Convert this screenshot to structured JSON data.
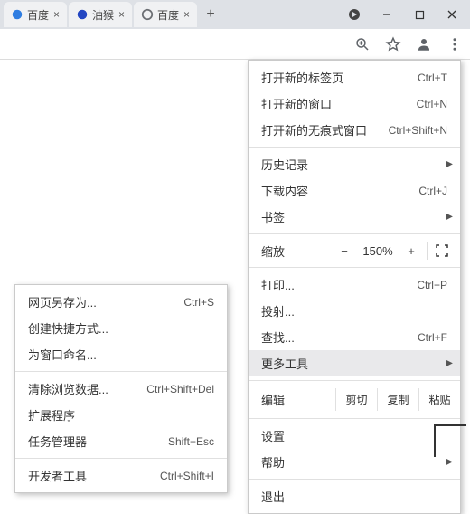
{
  "tabs": [
    {
      "title": "百度",
      "fav_color": "#2f7de1"
    },
    {
      "title": "油猴",
      "fav_color": "#2346c2"
    },
    {
      "title": "百度",
      "fav_color": "#6b6e73"
    }
  ],
  "menu": {
    "new_tab": {
      "label": "打开新的标签页",
      "shortcut": "Ctrl+T"
    },
    "new_window": {
      "label": "打开新的窗口",
      "shortcut": "Ctrl+N"
    },
    "incognito": {
      "label": "打开新的无痕式窗口",
      "shortcut": "Ctrl+Shift+N"
    },
    "history": {
      "label": "历史记录"
    },
    "downloads": {
      "label": "下载内容",
      "shortcut": "Ctrl+J"
    },
    "bookmarks": {
      "label": "书签"
    },
    "zoom_label": "缩放",
    "zoom_value": "150%",
    "print": {
      "label": "打印...",
      "shortcut": "Ctrl+P"
    },
    "cast": {
      "label": "投射..."
    },
    "find": {
      "label": "查找...",
      "shortcut": "Ctrl+F"
    },
    "more_tools": {
      "label": "更多工具"
    },
    "edit_label": "编辑",
    "cut": "剪切",
    "copy": "复制",
    "paste": "粘贴",
    "settings": {
      "label": "设置"
    },
    "help": {
      "label": "帮助"
    },
    "exit": {
      "label": "退出"
    }
  },
  "submenu": {
    "save_as": {
      "label": "网页另存为...",
      "shortcut": "Ctrl+S"
    },
    "create_shortcut": {
      "label": "创建快捷方式..."
    },
    "name_window": {
      "label": "为窗口命名..."
    },
    "clear_data": {
      "label": "清除浏览数据...",
      "shortcut": "Ctrl+Shift+Del"
    },
    "extensions": {
      "label": "扩展程序"
    },
    "task_manager": {
      "label": "任务管理器",
      "shortcut": "Shift+Esc"
    },
    "dev_tools": {
      "label": "开发者工具",
      "shortcut": "Ctrl+Shift+I"
    }
  }
}
